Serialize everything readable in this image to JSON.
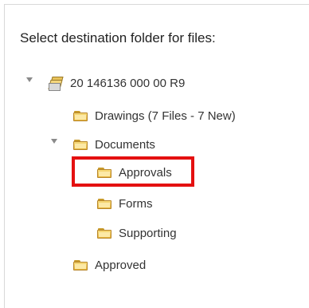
{
  "dialog": {
    "prompt": "Select destination folder for files:"
  },
  "tree": {
    "root": {
      "label": "20 146136 000 00 R9",
      "icon": "project-stack-icon",
      "expanded": true
    },
    "drawings": {
      "label": "Drawings (7 Files - 7 New)",
      "icon": "folder-icon"
    },
    "documents": {
      "label": "Documents",
      "icon": "folder-icon",
      "expanded": true
    },
    "approvals": {
      "label": "Approvals",
      "icon": "folder-icon",
      "highlighted": true
    },
    "forms": {
      "label": "Forms",
      "icon": "folder-icon"
    },
    "supporting": {
      "label": "Supporting",
      "icon": "folder-icon"
    },
    "approved": {
      "label": "Approved",
      "icon": "folder-icon"
    }
  },
  "colors": {
    "highlight_border": "#e41010",
    "text": "#333333",
    "folder": "#e5b43c"
  }
}
